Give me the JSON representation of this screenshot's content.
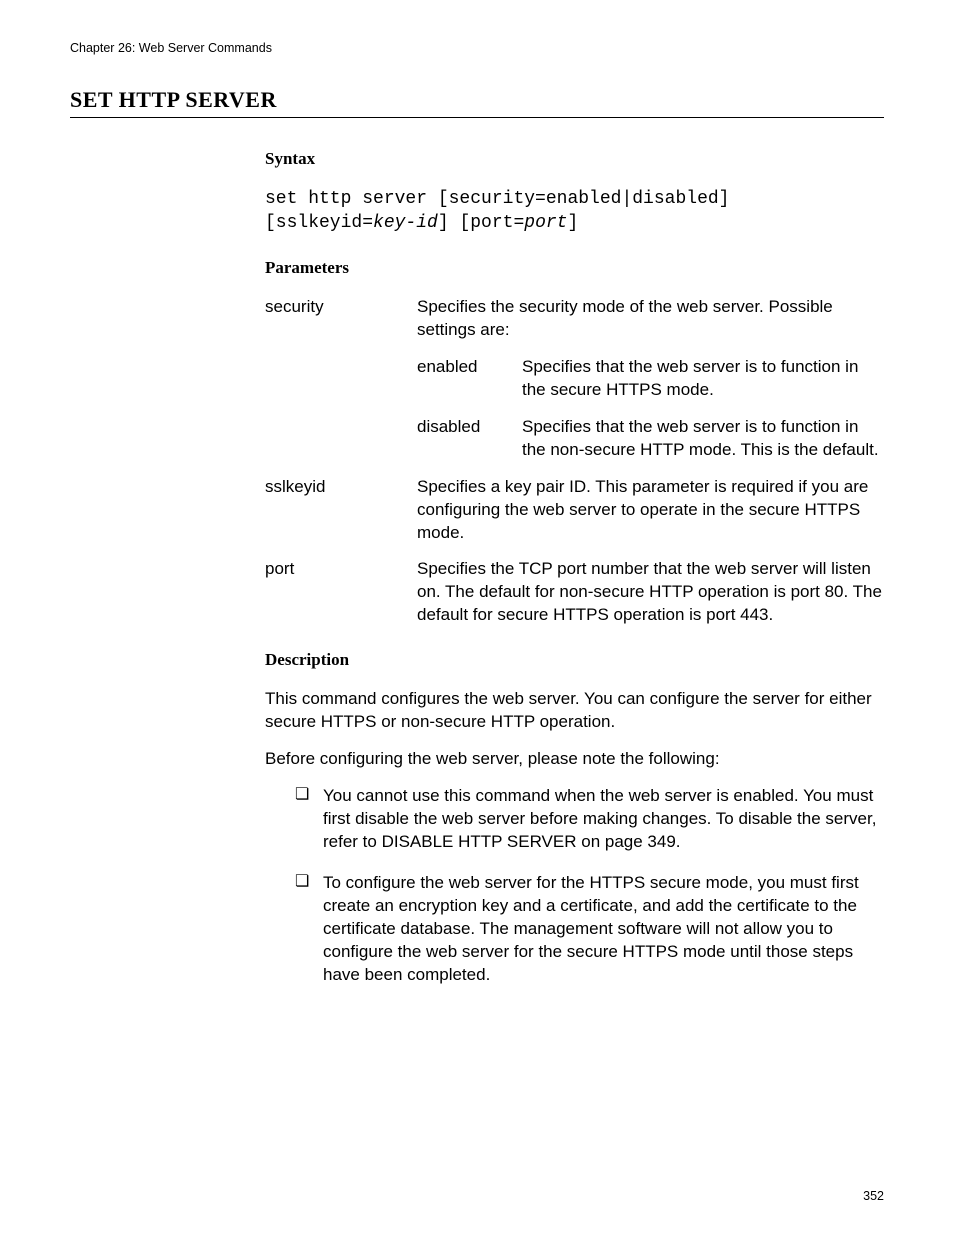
{
  "page": {
    "chapter": "Chapter 26: Web Server Commands",
    "title": "SET HTTP SERVER",
    "number": "352"
  },
  "syntax": {
    "heading": "Syntax",
    "line1_pre": "set http server [security=enabled|disabled] [sslkeyid=",
    "line1_it": "key-id",
    "line1_post": "] [port=",
    "line1_it2": "port",
    "line1_end": "]"
  },
  "params": {
    "heading": "Parameters",
    "security": {
      "name": "security",
      "intro": "Specifies the security mode of the web server. Possible settings are:",
      "enabled": {
        "label": "enabled",
        "text": "Specifies that the web server is to function in the secure HTTPS mode."
      },
      "disabled": {
        "label": "disabled",
        "text": "Specifies that the web server is to function in the non-secure HTTP mode. This is the default."
      }
    },
    "sslkeyid": {
      "name": "sslkeyid",
      "text": "Specifies a key pair ID. This parameter is required if you are configuring the web server to operate in the secure HTTPS mode."
    },
    "port": {
      "name": "port",
      "text": "Specifies the TCP port number that the web server will listen on. The default for non-secure HTTP operation is port 80. The default for secure HTTPS operation is port 443."
    }
  },
  "desc": {
    "heading": "Description",
    "p1": "This command configures the web server. You can configure the server for either secure HTTPS or non-secure HTTP operation.",
    "p2": "Before configuring the web server, please note the following:",
    "b1": "You cannot use this command when the web server is enabled. You must first disable the web server before making changes. To disable the server, refer to DISABLE HTTP SERVER on page 349.",
    "b2": "To configure the web server for the HTTPS secure mode, you must first create an encryption key and a certificate, and add the certificate to the certificate database. The management software will not allow you to configure the web server for the secure HTTPS mode until those steps have been completed."
  }
}
